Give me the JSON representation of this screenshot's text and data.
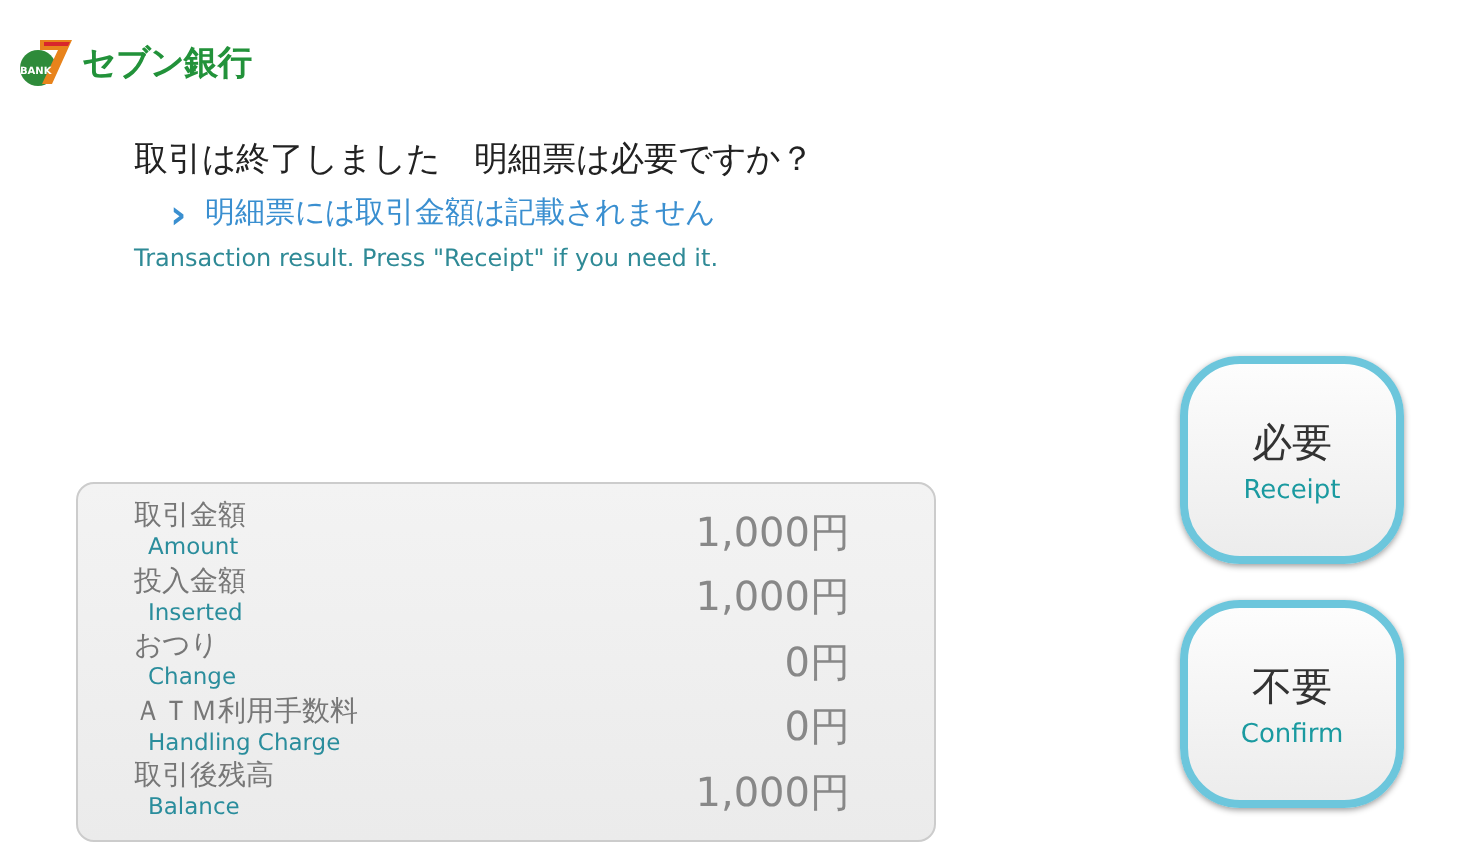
{
  "logo": {
    "badge": "BANK",
    "name": "セブン銀行"
  },
  "heading": "取引は終了しました　明細票は必要ですか？",
  "notice": {
    "arrow": "›",
    "text": "明細票には取引金額は記載されません"
  },
  "english": "Transaction result. Press \"Receipt\" if you need it.",
  "summary": [
    {
      "label": "取引金額",
      "sublabel": "Amount",
      "value": "1,000円"
    },
    {
      "label": "投入金額",
      "sublabel": "Inserted",
      "value": "1,000円"
    },
    {
      "label": "おつり",
      "sublabel": "Change",
      "value": "0円"
    },
    {
      "label": "ＡＴＭ利用手数料",
      "sublabel": "Handling Charge",
      "value": "0円"
    },
    {
      "label": "取引後残高",
      "sublabel": "Balance",
      "value": "1,000円"
    }
  ],
  "buttons": [
    {
      "label": "必要",
      "sublabel": "Receipt"
    },
    {
      "label": "不要",
      "sublabel": "Confirm"
    }
  ]
}
